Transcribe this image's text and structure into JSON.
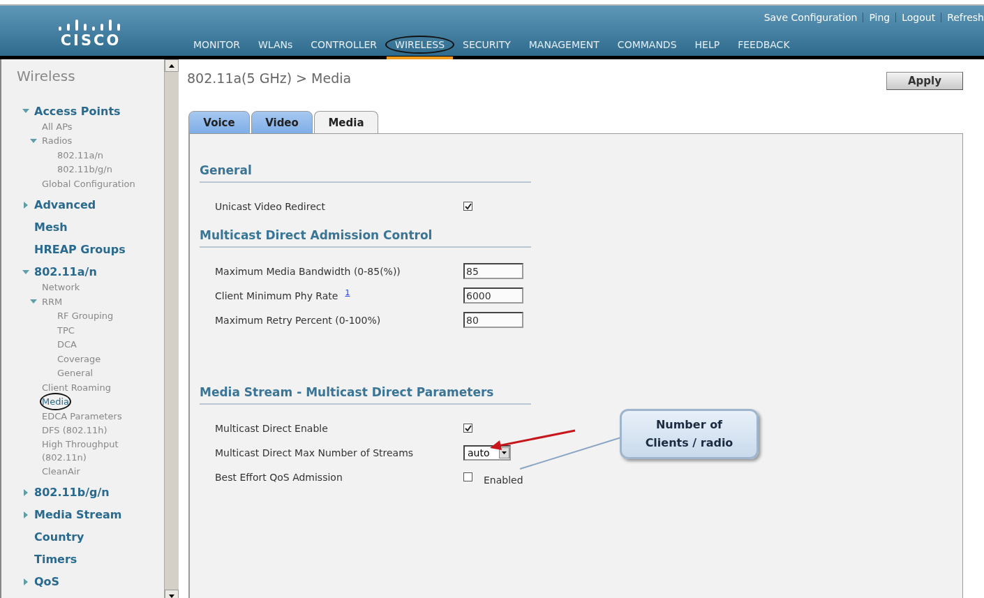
{
  "header": {
    "logo": "CISCO",
    "top_links": [
      "Save Configuration",
      "Ping",
      "Logout",
      "Refresh"
    ],
    "nav": [
      {
        "label": "MONITOR",
        "selected": false
      },
      {
        "label": "WLANs",
        "selected": false
      },
      {
        "label": "CONTROLLER",
        "selected": false
      },
      {
        "label": "WIRELESS",
        "selected": true
      },
      {
        "label": "SECURITY",
        "selected": false
      },
      {
        "label": "MANAGEMENT",
        "selected": false
      },
      {
        "label": "COMMANDS",
        "selected": false
      },
      {
        "label": "HELP",
        "selected": false
      },
      {
        "label": "FEEDBACK",
        "selected": false
      }
    ]
  },
  "sidebar": {
    "title": "Wireless",
    "items": [
      {
        "label": "Access Points",
        "kind": "group",
        "expanded": true,
        "children": [
          {
            "label": "All APs",
            "kind": "link",
            "selected": false
          },
          {
            "label": "Radios",
            "kind": "link",
            "expanded": true,
            "selected": false,
            "children": [
              {
                "label": "802.11a/n",
                "kind": "link",
                "selected": false
              },
              {
                "label": "802.11b/g/n",
                "kind": "link",
                "selected": false
              }
            ]
          },
          {
            "label": "Global Configuration",
            "kind": "link",
            "selected": false
          }
        ]
      },
      {
        "label": "Advanced",
        "kind": "group",
        "expanded": false
      },
      {
        "label": "Mesh",
        "kind": "group"
      },
      {
        "label": "HREAP Groups",
        "kind": "group"
      },
      {
        "label": "802.11a/n",
        "kind": "group",
        "expanded": true,
        "children": [
          {
            "label": "Network",
            "kind": "link",
            "selected": false
          },
          {
            "label": "RRM",
            "kind": "link",
            "expanded": true,
            "selected": false,
            "children": [
              {
                "label": "RF Grouping",
                "kind": "link",
                "selected": false
              },
              {
                "label": "TPC",
                "kind": "link",
                "selected": false
              },
              {
                "label": "DCA",
                "kind": "link",
                "selected": false
              },
              {
                "label": "Coverage",
                "kind": "link",
                "selected": false
              },
              {
                "label": "General",
                "kind": "link",
                "selected": false
              }
            ]
          },
          {
            "label": "Client Roaming",
            "kind": "link",
            "selected": false
          },
          {
            "label": "Media",
            "kind": "link",
            "selected": true
          },
          {
            "label": "EDCA Parameters",
            "kind": "link",
            "selected": false
          },
          {
            "label": "DFS (802.11h)",
            "kind": "link",
            "selected": false
          },
          {
            "label": "High Throughput (802.11n)",
            "kind": "link",
            "selected": false
          },
          {
            "label": "CleanAir",
            "kind": "link",
            "selected": false
          }
        ]
      },
      {
        "label": "802.11b/g/n",
        "kind": "group",
        "expanded": false
      },
      {
        "label": "Media Stream",
        "kind": "group",
        "expanded": false
      },
      {
        "label": "Country",
        "kind": "group"
      },
      {
        "label": "Timers",
        "kind": "group"
      },
      {
        "label": "QoS",
        "kind": "group",
        "expanded": false
      }
    ]
  },
  "content": {
    "breadcrumb": "802.11a(5 GHz) > Media",
    "apply": "Apply",
    "tabs": [
      {
        "label": "Voice",
        "selected": false
      },
      {
        "label": "Video",
        "selected": false
      },
      {
        "label": "Media",
        "selected": true
      }
    ],
    "sections": [
      {
        "title": "General",
        "rows": [
          {
            "kind": "checkbox",
            "label": "Unicast Video Redirect",
            "checked": true
          }
        ]
      },
      {
        "title": "Multicast Direct Admission Control",
        "rows": [
          {
            "kind": "input",
            "label": "Maximum Media Bandwidth (0-85(%))",
            "value": "85"
          },
          {
            "kind": "input",
            "label": "Client Minimum Phy Rate",
            "footnote": "1",
            "value": "6000"
          },
          {
            "kind": "input",
            "label": "Maximum Retry Percent (0-100%)",
            "value": "80"
          }
        ]
      },
      {
        "title": "Media Stream - Multicast Direct Parameters",
        "rows": [
          {
            "kind": "checkbox",
            "label": "Multicast Direct Enable",
            "checked": true
          },
          {
            "kind": "select",
            "label": "Multicast Direct Max Number of Streams",
            "value": "auto"
          },
          {
            "kind": "checkbox",
            "label": "Best Effort QoS Admission",
            "checked": false,
            "option_label": "Enabled"
          }
        ]
      }
    ],
    "callout": {
      "lines": [
        "Number of",
        "Clients / radio"
      ]
    }
  }
}
